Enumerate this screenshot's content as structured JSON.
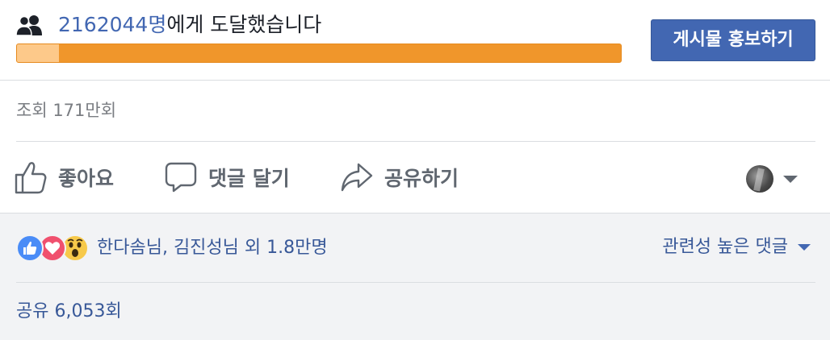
{
  "reach": {
    "count": "2162044명",
    "suffix": "에게 도달했습니다",
    "organic_fraction": 0.07,
    "boost_button": "게시물 홍보하기"
  },
  "views": "조회 171만회",
  "actions": {
    "like": "좋아요",
    "comment": "댓글 달기",
    "share": "공유하기"
  },
  "reactions": {
    "icons": [
      "like-icon",
      "love-icon",
      "wow-icon"
    ],
    "summary": "한다솜님, 김진성님 외 1.8만명"
  },
  "comments_sort": "관련성 높은 댓글",
  "shares": "공유 6,053회",
  "colors": {
    "accent": "#4267b2",
    "bar_paid": "#f0962b",
    "bar_organic": "#fdc98a",
    "link": "#385898"
  }
}
